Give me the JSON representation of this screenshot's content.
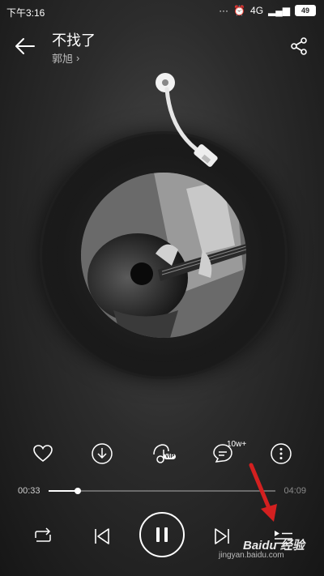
{
  "status_bar": {
    "time": "下午3:16",
    "network": "4G",
    "battery": "49"
  },
  "header": {
    "title": "不找了",
    "artist": "郭旭",
    "artist_chevron": "›"
  },
  "actions": {
    "comment_count": "10w+",
    "vip_badge": "VIP"
  },
  "progress": {
    "elapsed": "00:33",
    "total": "04:09",
    "fraction": 0.13
  },
  "watermark": {
    "logo": "Baidu 经验",
    "url": "jingyan.baidu.com"
  },
  "colors": {
    "accent": "#ffffff",
    "annotation_arrow": "#d32020"
  }
}
